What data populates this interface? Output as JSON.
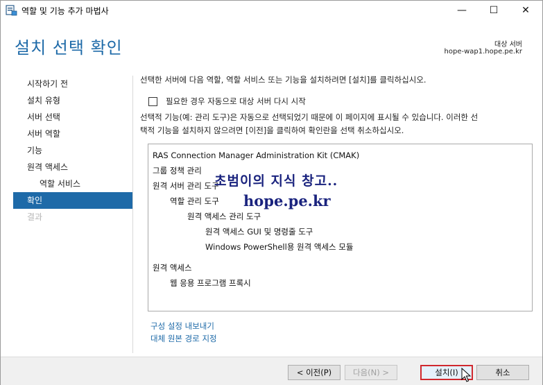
{
  "window": {
    "title": "역할 및 기능 추가 마법사",
    "minimize_glyph": "—",
    "maximize_glyph": "☐",
    "close_glyph": "✕"
  },
  "header": {
    "page_title": "설치 선택 확인",
    "target_label": "대상 서버",
    "target_server": "hope-wap1.hope.pe.kr"
  },
  "nav": {
    "items": [
      {
        "label": "시작하기 전"
      },
      {
        "label": "설치 유형"
      },
      {
        "label": "서버 선택"
      },
      {
        "label": "서버 역할"
      },
      {
        "label": "기능"
      },
      {
        "label": "원격 액세스"
      },
      {
        "label": "역할 서비스"
      },
      {
        "label": "확인"
      },
      {
        "label": "결과"
      }
    ]
  },
  "content": {
    "intro": "선택한 서버에 다음 역할, 역할 서비스 또는 기능을 설치하려면 [설치]를 클릭하십시오.",
    "restart_checkbox_label": "필요한 경우 자동으로 대상 서버 다시 시작",
    "restart_checked": false,
    "note_line1": "선택적 기능(예: 관리 도구)은 자동으로 선택되었기 때문에 이 페이지에 표시될 수 있습니다. 이러한 선",
    "note_line2": "택적 기능을 설치하지 않으려면 [이전]을 클릭하여 확인란을 선택 취소하십시오.",
    "features": [
      "RAS Connection Manager Administration Kit (CMAK)",
      "그룹 정책 관리",
      "원격 서버 관리 도구",
      "역할 관리 도구",
      "원격 액세스 관리 도구",
      "원격 액세스 GUI 및 명령줄 도구",
      "Windows PowerShell용 원격 액세스 모듈",
      "원격 액세스",
      "웹 응용 프로그램 프록시"
    ],
    "watermark_line1": "초범이의 지식 창고..",
    "watermark_line2": "hope.pe.kr",
    "export_link": "구성 설정 내보내기",
    "alt_source_link": "대체 원본 경로 지정"
  },
  "footer": {
    "prev_label": "< 이전(P)",
    "next_label": "다음(N) >",
    "install_label": "설치(I)",
    "cancel_label": "취소"
  },
  "colors": {
    "accent": "#1e6aa8",
    "highlight_border": "#d0282e"
  }
}
